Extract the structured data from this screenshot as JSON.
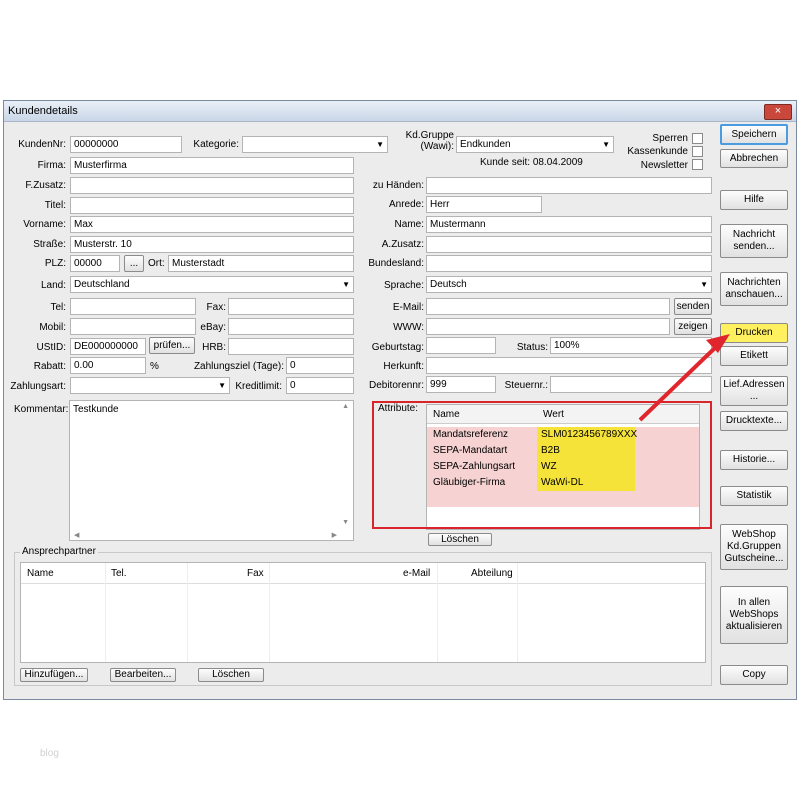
{
  "window": {
    "title": "Kundendetails",
    "close": "×"
  },
  "fields": {
    "kundennr": {
      "label": "KundenNr:",
      "value": "00000000"
    },
    "kategorie": {
      "label": "Kategorie:",
      "value": ""
    },
    "kdgruppe": {
      "label": "Kd.Gruppe\n(Wawi):",
      "value": "Endkunden"
    },
    "kunde_seit": "Kunde seit: 08.04.2009",
    "firma": {
      "label": "Firma:",
      "value": "Musterfirma"
    },
    "fzusatz": {
      "label": "F.Zusatz:",
      "value": ""
    },
    "titel": {
      "label": "Titel:",
      "value": ""
    },
    "vorname": {
      "label": "Vorname:",
      "value": "Max"
    },
    "strasse": {
      "label": "Straße:",
      "value": "Musterstr. 10"
    },
    "plz": {
      "label": "PLZ:",
      "value": "00000",
      "button": "...",
      "ort_label": "Ort:",
      "ort_value": "Musterstadt"
    },
    "land": {
      "label": "Land:",
      "value": "Deutschland"
    },
    "tel": {
      "label": "Tel:",
      "value": ""
    },
    "fax": {
      "label": "Fax:",
      "value": ""
    },
    "mobil": {
      "label": "Mobil:",
      "value": ""
    },
    "ebay": {
      "label": "eBay:",
      "value": ""
    },
    "ustid": {
      "label": "UStID:",
      "value": "DE000000000",
      "button": "prüfen..."
    },
    "hrb": {
      "label": "HRB:",
      "value": ""
    },
    "rabatt": {
      "label": "Rabatt:",
      "value": "0.00",
      "unit": "%"
    },
    "zahlungsziel": {
      "label": "Zahlungsziel (Tage):",
      "value": "0"
    },
    "zahlungsart": {
      "label": "Zahlungsart:",
      "value": ""
    },
    "kreditlimit": {
      "label": "Kreditlimit:",
      "value": "0"
    },
    "kommentar": {
      "label": "Kommentar:",
      "value": "Testkunde"
    },
    "zu_haenden": {
      "label": "zu Händen:",
      "value": ""
    },
    "anrede": {
      "label": "Anrede:",
      "value": "Herr"
    },
    "name": {
      "label": "Name:",
      "value": "Mustermann"
    },
    "azusatz": {
      "label": "A.Zusatz:",
      "value": ""
    },
    "bundesland": {
      "label": "Bundesland:",
      "value": ""
    },
    "sprache": {
      "label": "Sprache:",
      "value": "Deutsch"
    },
    "email": {
      "label": "E-Mail:",
      "value": "",
      "button": "senden"
    },
    "www": {
      "label": "WWW:",
      "value": "",
      "button": "zeigen"
    },
    "geburtstag": {
      "label": "Geburtstag:",
      "value": ""
    },
    "status": {
      "label": "Status:",
      "value": "100%"
    },
    "herkunft": {
      "label": "Herkunft:",
      "value": ""
    },
    "debitorennr": {
      "label": "Debitorennr:",
      "value": "999"
    },
    "steuernr": {
      "label": "Steuernr.:",
      "value": ""
    }
  },
  "flags": {
    "sperren": "Sperren",
    "kassenkunde": "Kassenkunde",
    "newsletter": "Newsletter"
  },
  "attribute": {
    "label": "Attribute:",
    "columns": [
      "Name",
      "Wert"
    ],
    "rows": [
      {
        "name": "Mandatsreferenz",
        "wert": "SLM0123456789XXX"
      },
      {
        "name": "SEPA-Mandatart",
        "wert": "B2B"
      },
      {
        "name": "SEPA-Zahlungsart",
        "wert": "WZ"
      },
      {
        "name": "Gläubiger-Firma",
        "wert": "WaWi-DL"
      }
    ],
    "delete_button": "Löschen"
  },
  "ansprechpartner": {
    "title": "Ansprechpartner",
    "columns": [
      "Name",
      "Tel.",
      "Fax",
      "e-Mail",
      "Abteilung"
    ],
    "buttons": {
      "add": "Hinzufügen...",
      "edit": "Bearbeiten...",
      "delete": "Löschen"
    }
  },
  "sidebar": {
    "speichern": "Speichern",
    "abbrechen": "Abbrechen",
    "hilfe": "Hilfe",
    "nachricht_senden": "Nachricht\nsenden...",
    "nachrichten_anschauen": "Nachrichten\nanschauen...",
    "drucken": "Drucken",
    "etikett": "Etikett",
    "lief_adressen": "Lief.Adressen\n...",
    "drucktexte": "Drucktexte...",
    "historie": "Historie...",
    "statistik": "Statistik",
    "webshop": "WebShop\nKd.Gruppen\nGutscheine...",
    "alle_webshops": "In allen\nWebShops\naktualisieren",
    "copy": "Copy"
  },
  "watermark": "blog",
  "colors": {
    "highlight_border": "#d8242a",
    "arrow": "#e0262c",
    "drucken": "#fff060",
    "attr_row": "#f6d2d2",
    "attr_value": "#f5e33a"
  }
}
